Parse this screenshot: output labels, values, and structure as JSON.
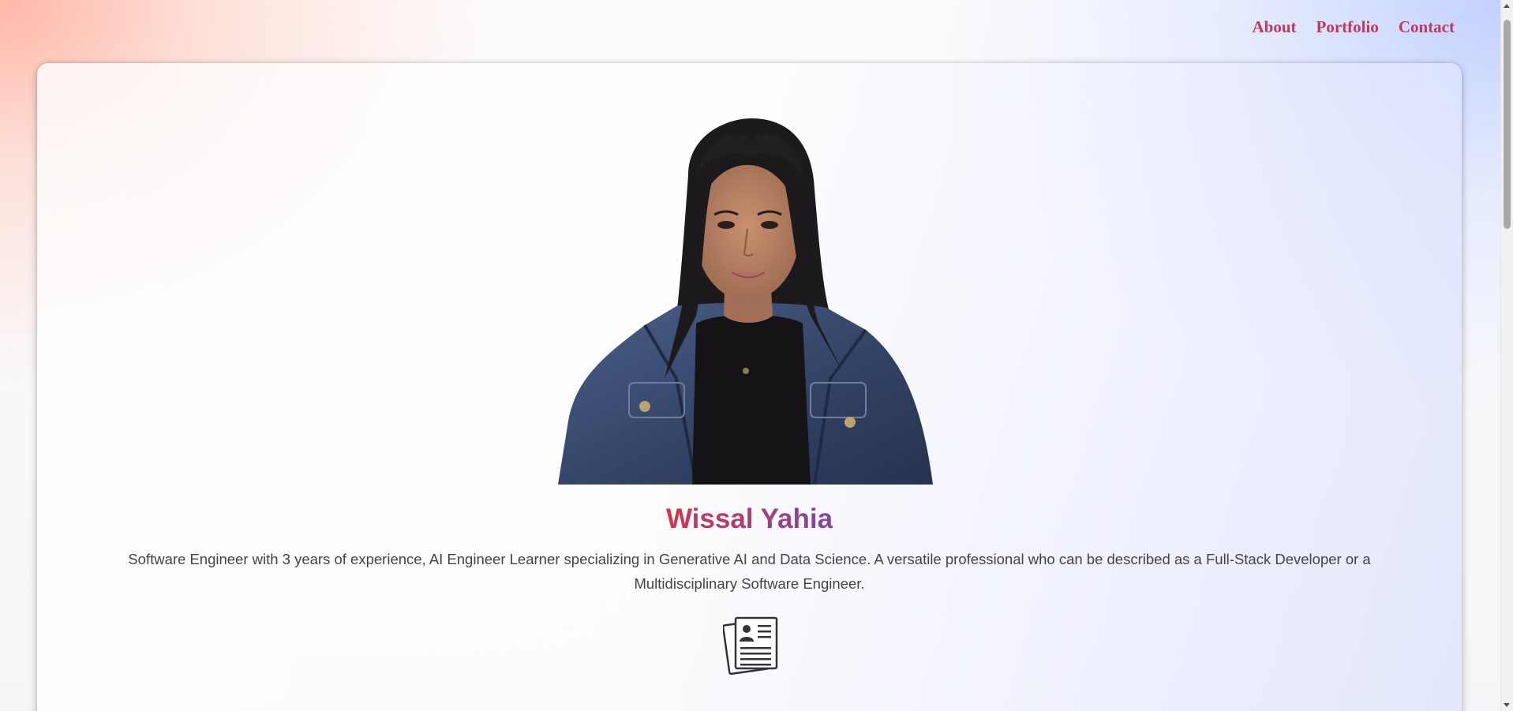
{
  "nav": {
    "items": [
      {
        "label": "About"
      },
      {
        "label": "Portfolio"
      },
      {
        "label": "Contact"
      }
    ],
    "link_color": "#c0395c"
  },
  "profile": {
    "name": "Wissal Yahia",
    "bio": "Software Engineer with 3 years of experience, AI Engineer Learner specializing in Generative AI and Data Science. A versatile professional who can be described as a Full-Stack Developer or a Multidisciplinary Software Engineer.",
    "name_gradient": [
      "#d6334f",
      "#7c4a9e"
    ],
    "photo_icon": "profile-photo",
    "resume_icon": "resume-document-icon"
  },
  "colors": {
    "text": "#444444",
    "background_left": "#ffb09a",
    "background_right": "#c7d2ff"
  }
}
